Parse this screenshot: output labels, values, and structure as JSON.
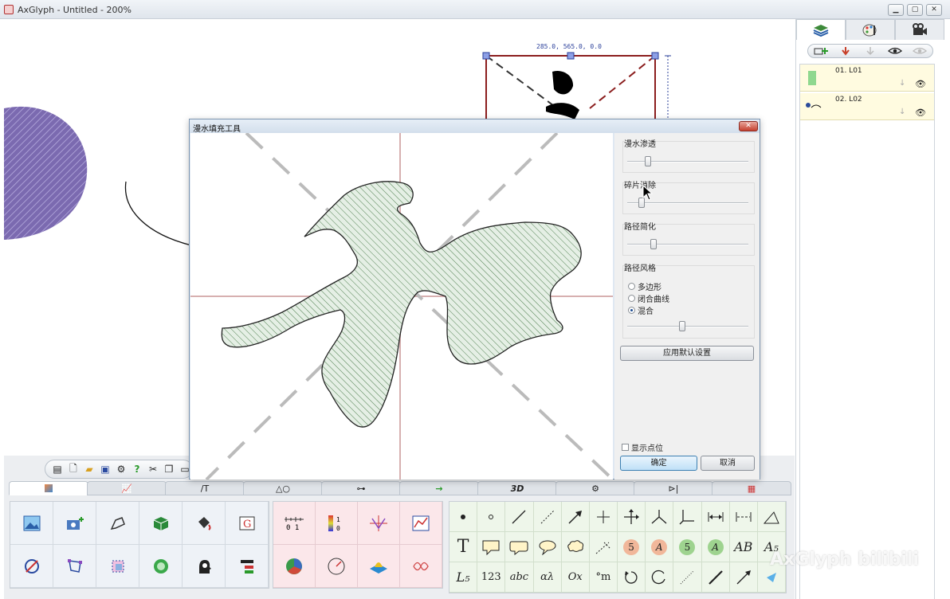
{
  "window": {
    "title": "AxGlyph - Untitled - 200%",
    "minimize": "▁",
    "maximize": "▢",
    "close": "✕"
  },
  "canvas": {
    "coord_label": "285.0, 565.0, 0.0"
  },
  "dialog": {
    "title": "漫水填充工具",
    "close": "✕",
    "groups": {
      "flood": "漫水渗透",
      "fragment": "碎片消除",
      "simplify": "路径简化",
      "style": "路径风格"
    },
    "sliders": {
      "flood": 0.15,
      "fragment": 0.1,
      "simplify": 0.2,
      "style": 0.45
    },
    "style_options": [
      "多边形",
      "闭合曲线",
      "混合"
    ],
    "selected_style": "混合",
    "apply_defaults": "应用默认设置",
    "show_points": "显示点位",
    "ok": "确定",
    "cancel": "取消"
  },
  "layers": [
    {
      "name": "01. L01",
      "swatch": "#8fd88f"
    },
    {
      "name": "02. L02",
      "swatch": "#2a4a9a"
    }
  ],
  "bottom_tabs": [
    "",
    "",
    "/T",
    "△○",
    "",
    "→",
    "3D",
    "",
    "",
    ""
  ],
  "panel_c": {
    "row1_text": {
      "letters": "AB",
      "a5": "A₅"
    },
    "row2": [
      "L₅",
      "123",
      "abc",
      "αλ",
      "Ox",
      "°m"
    ],
    "bubbles": [
      {
        "text": "5",
        "color": "#f1b79a"
      },
      {
        "text": "A",
        "color": "#f1b79a"
      },
      {
        "text": "5",
        "color": "#9ed38f"
      },
      {
        "text": "A",
        "color": "#9ed38f"
      }
    ]
  },
  "panel_b": {
    "scale_label": "0 1",
    "bar_label": "1 0"
  },
  "colors": {
    "accent": "#3c7fb1",
    "hatch": "#4f7f4f",
    "fill": "#e5efe5",
    "purple": "#7b6ab0"
  },
  "watermark": "AxGlyph  bilibili"
}
